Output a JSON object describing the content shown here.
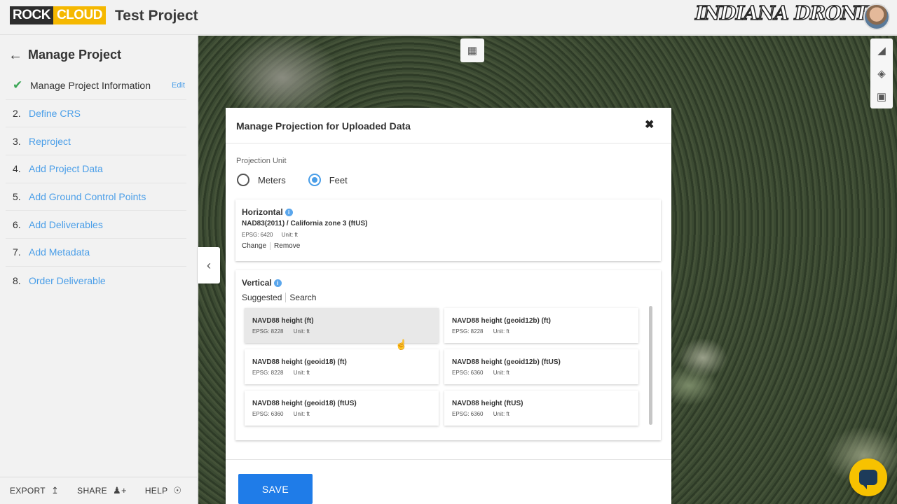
{
  "header": {
    "logo_rock": "ROCK",
    "logo_cloud": "CLOUD",
    "project_title": "Test Project",
    "brand": "INDIANA DRONES"
  },
  "sidebar": {
    "back_label": "Manage Project",
    "completed_step": {
      "label": "Manage Project Information",
      "edit_label": "Edit"
    },
    "steps": [
      {
        "num": "2.",
        "label": "Define CRS"
      },
      {
        "num": "3.",
        "label": "Reproject"
      },
      {
        "num": "4.",
        "label": "Add Project Data"
      },
      {
        "num": "5.",
        "label": "Add Ground Control Points"
      },
      {
        "num": "6.",
        "label": "Add Deliverables"
      },
      {
        "num": "7.",
        "label": "Add Metadata"
      },
      {
        "num": "8.",
        "label": "Order Deliverable"
      }
    ],
    "bottom": {
      "export": "EXPORT",
      "share": "SHARE",
      "help": "HELP"
    }
  },
  "modal": {
    "title": "Manage Projection for Uploaded Data",
    "unit_label": "Projection Unit",
    "units": [
      {
        "label": "Meters",
        "selected": false
      },
      {
        "label": "Feet",
        "selected": true
      }
    ],
    "horizontal": {
      "title": "Horizontal",
      "crs_name": "NAD83(2011) / California zone 3 (ftUS)",
      "epsg": "EPSG: 6420",
      "unit": "Unit: ft",
      "change": "Change",
      "remove": "Remove"
    },
    "vertical": {
      "title": "Vertical",
      "tab_suggested": "Suggested",
      "tab_search": "Search",
      "options": [
        {
          "name": "NAVD88 height (ft)",
          "epsg": "EPSG: 8228",
          "unit": "Unit: ft",
          "selected": true
        },
        {
          "name": "NAVD88 height (geoid12b) (ft)",
          "epsg": "EPSG: 8228",
          "unit": "Unit: ft",
          "selected": false
        },
        {
          "name": "NAVD88 height (geoid18) (ft)",
          "epsg": "EPSG: 8228",
          "unit": "Unit: ft",
          "selected": false
        },
        {
          "name": "NAVD88 height (geoid12b) (ftUS)",
          "epsg": "EPSG: 6360",
          "unit": "Unit: ft",
          "selected": false
        },
        {
          "name": "NAVD88 height (geoid18) (ftUS)",
          "epsg": "EPSG: 6360",
          "unit": "Unit: ft",
          "selected": false
        },
        {
          "name": "NAVD88 height (ftUS)",
          "epsg": "EPSG: 6360",
          "unit": "Unit: ft",
          "selected": false
        }
      ]
    },
    "save_label": "SAVE"
  },
  "colors": {
    "accent": "#4a9ee8",
    "save_button": "#1f7ce8",
    "logo_yellow": "#f5b800",
    "chat_yellow": "#f7c200",
    "check_green": "#3aa655"
  },
  "icons": {
    "back": "arrow-left-icon",
    "check": "checkmark-icon",
    "collapse": "chevron-left-icon",
    "map": "map-icon",
    "measure": "ruler-icon",
    "layers": "layers-icon",
    "save": "floppy-disk-icon",
    "close": "close-icon",
    "chat": "chat-icon"
  }
}
